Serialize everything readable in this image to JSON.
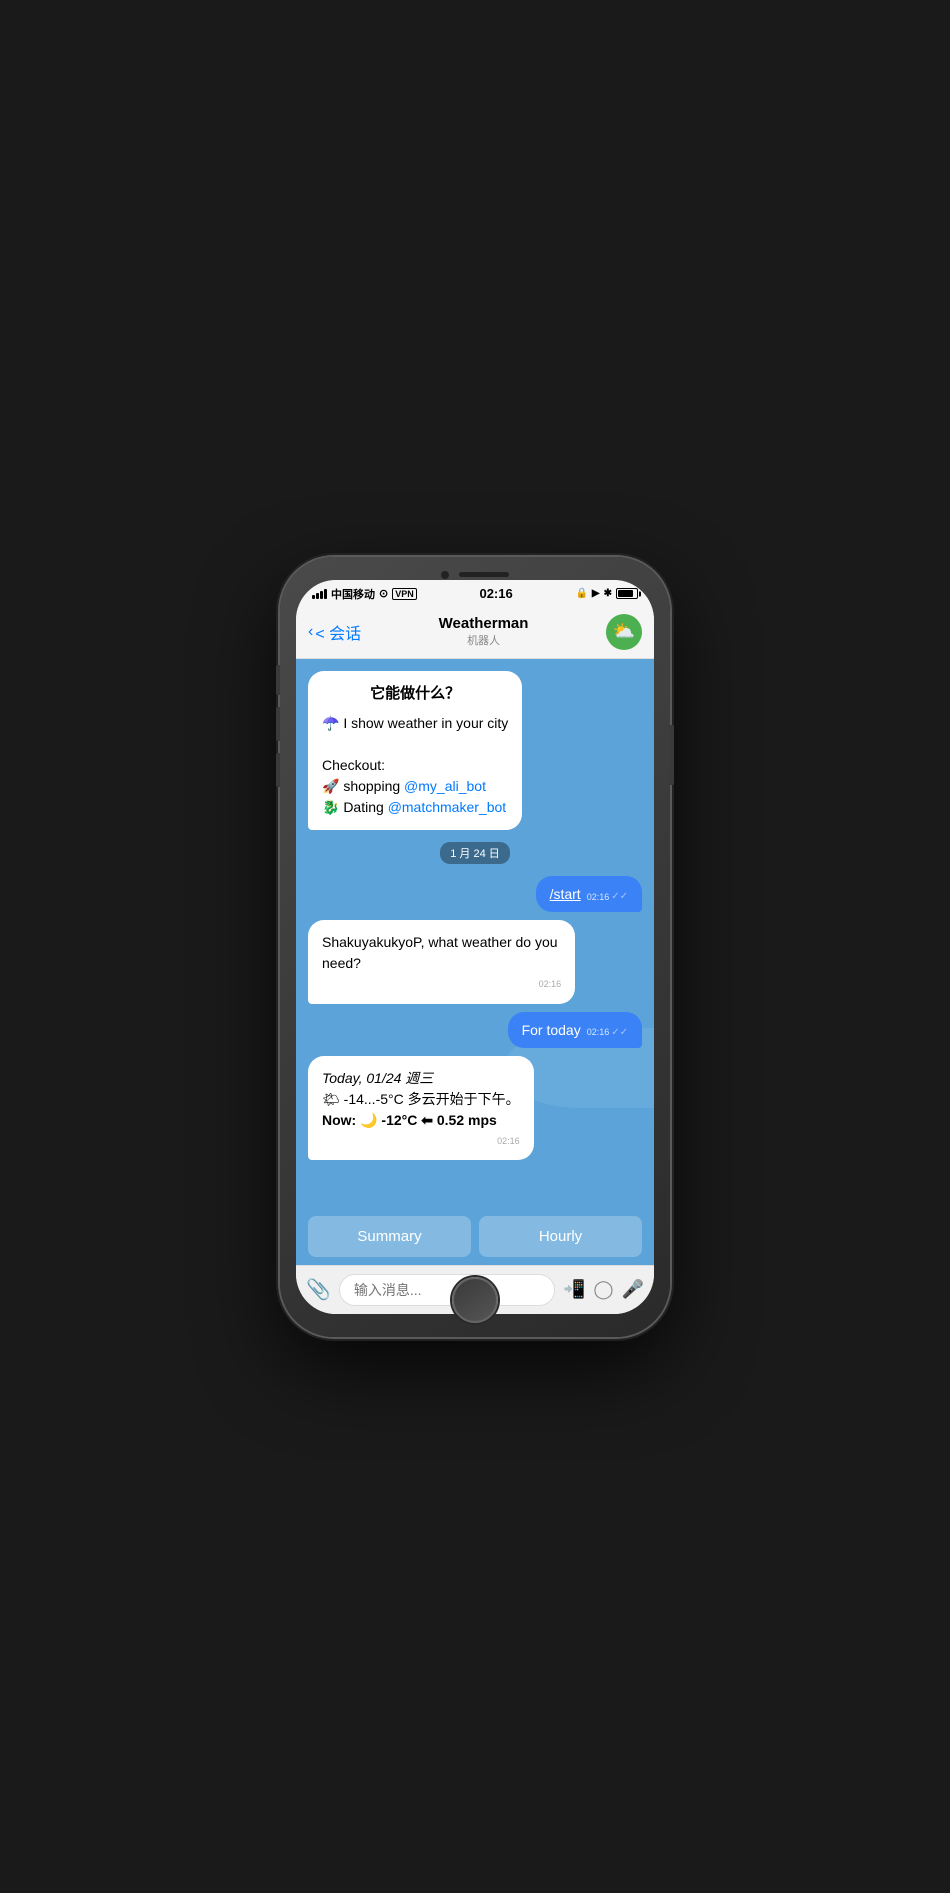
{
  "phone": {
    "status": {
      "carrier": "中国移动",
      "wifi": "WiFi",
      "vpn": "VPN",
      "time": "02:16",
      "battery": "85%"
    },
    "nav": {
      "back_label": "< 会话",
      "title": "Weatherman",
      "subtitle": "机器人"
    },
    "chat": {
      "intro_bubble": {
        "title": "它能做什么？",
        "line1": "☂️ I show weather in your city",
        "line2": "Checkout:",
        "line3": "🚀 shopping @my_ali_bot",
        "line4": "🐉 Dating @matchmaker_bot"
      },
      "date_badge": "1 月 24 日",
      "msg_start": {
        "text": "/start",
        "time": "02:16",
        "is_user": true
      },
      "msg_bot1": {
        "text": "ShakuyakukyoP, what weather do you need?",
        "time": "02:16",
        "is_user": false
      },
      "msg_for_today": {
        "text": "For today",
        "time": "02:16",
        "is_user": true
      },
      "msg_weather": {
        "line1": "Today, 01/24 週三",
        "line2": "🌤 -14...-5°C 多云开始于下午。",
        "line3": "Now: 🌙 -12°C ⬅ 0.52 mps",
        "time": "02:16",
        "is_user": false
      }
    },
    "buttons": {
      "summary": "Summary",
      "hourly": "Hourly"
    },
    "input": {
      "placeholder": "输入消息..."
    }
  }
}
